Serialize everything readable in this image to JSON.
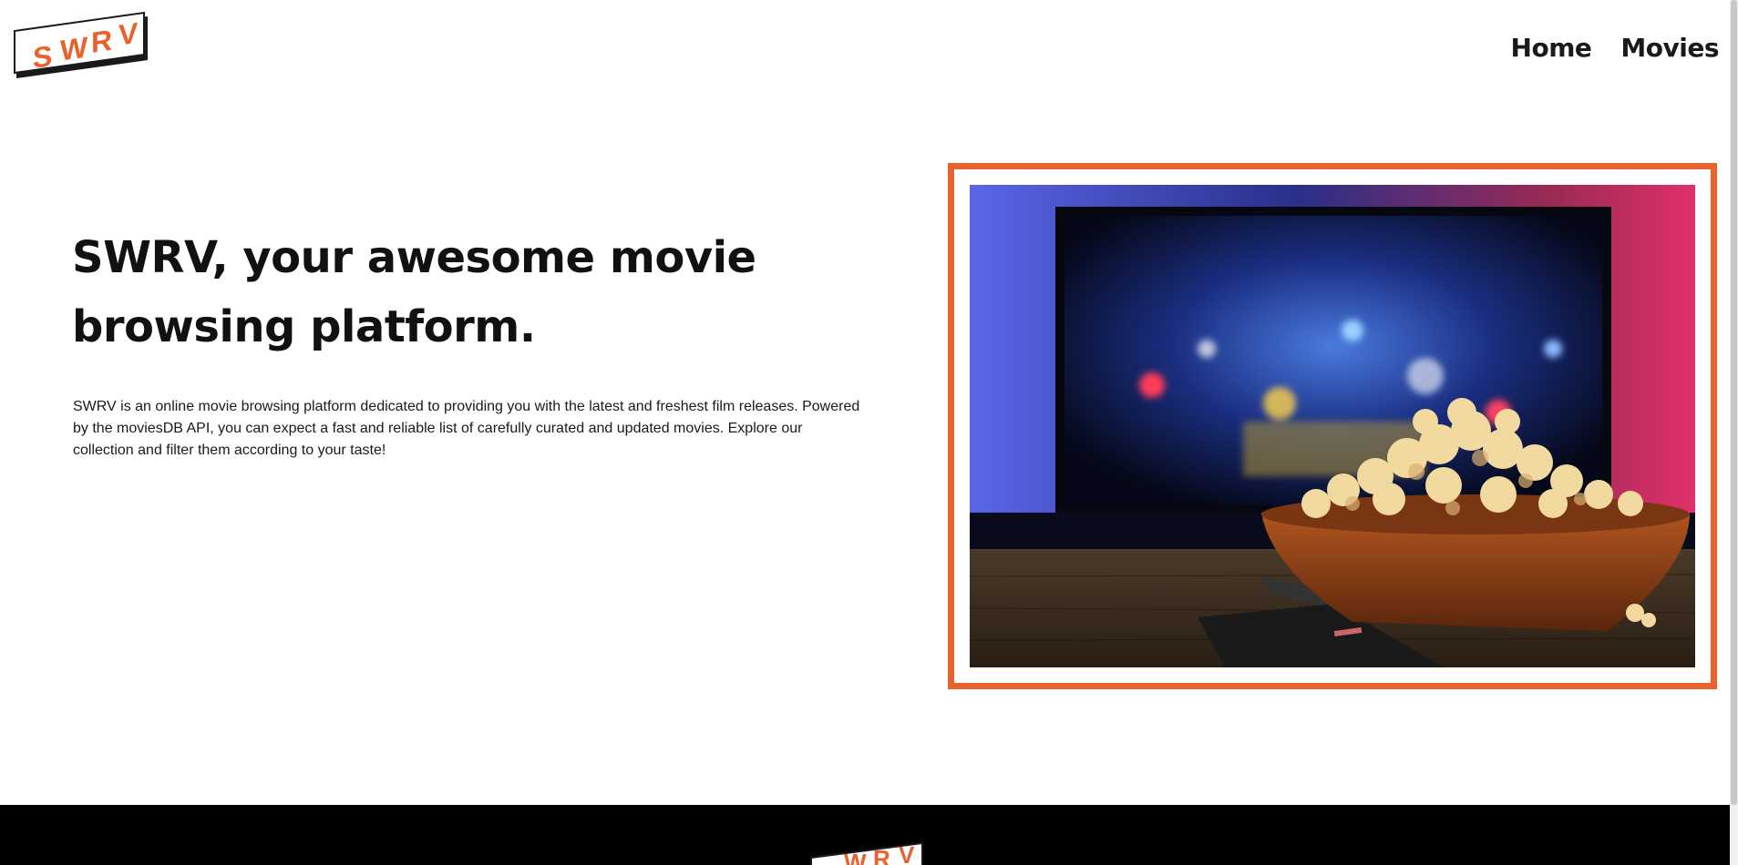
{
  "brand": {
    "logo_text": "SWRV",
    "accent_color": "#e8622c"
  },
  "nav": {
    "items": [
      {
        "label": "Home"
      },
      {
        "label": "Movies"
      }
    ]
  },
  "hero": {
    "title": "SWRV, your awesome movie browsing platform.",
    "description": "SWRV is an online movie browsing platform dedicated to providing you with the latest and freshest film releases. Powered by the moviesDB API, you can expect a fast and reliable list of carefully curated and updated movies. Explore our collection and filter them according to your taste!",
    "image_icon": "popcorn-tv-photo"
  },
  "footer": {
    "logo_text": "SWRV"
  }
}
